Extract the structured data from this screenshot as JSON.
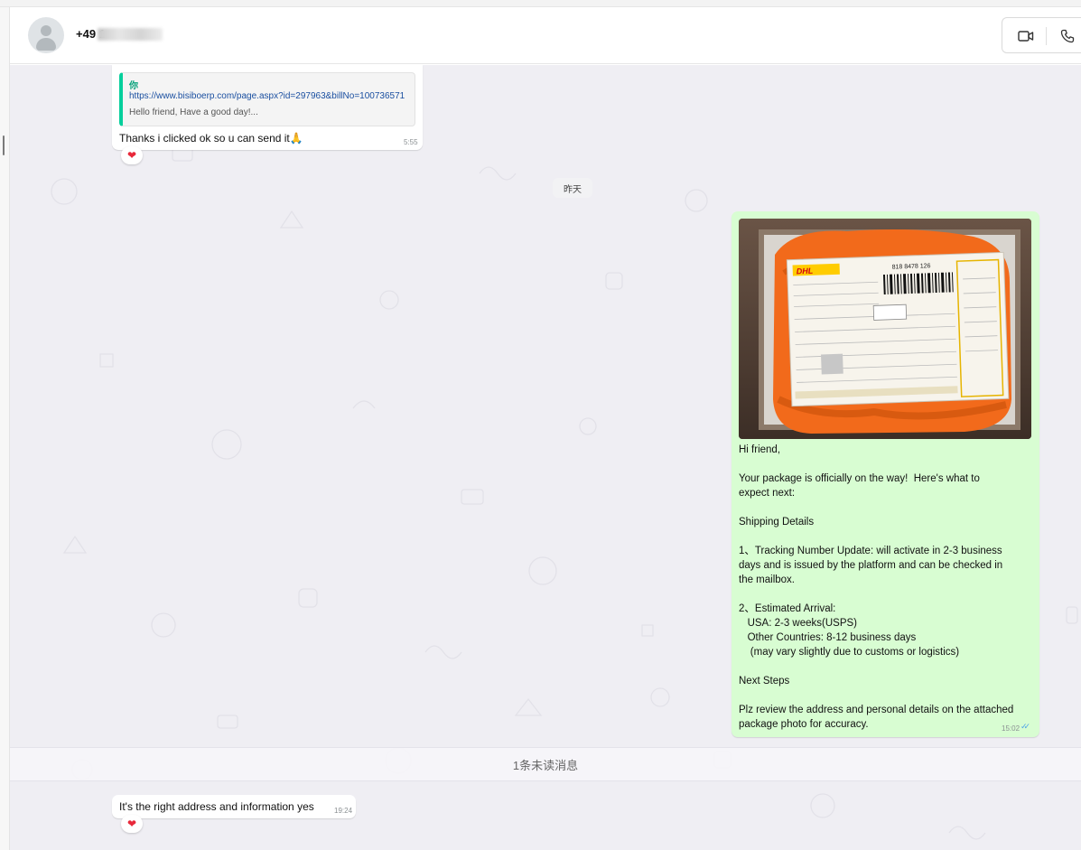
{
  "header": {
    "contact_name": "+49 1",
    "icons": {
      "video": "video-camera-icon",
      "phone": "phone-icon",
      "avatar": "default-avatar-icon"
    }
  },
  "chat": {
    "messages": [
      {
        "direction": "incoming",
        "quote": {
          "author": "你",
          "link": "https://www.bisiboerp.com/page.aspx?id=297963&billNo=100736571",
          "text": "Hello friend, Have a good day!..."
        },
        "text": "Thanks i clicked ok so u can send it🙏",
        "time": "5:55",
        "reaction": "❤"
      },
      {
        "direction": "outgoing",
        "has_image": true,
        "lines": [
          "Hi friend,",
          "",
          "Your package is officially on the way!  Here's what to",
          "expect next:",
          "",
          "Shipping Details",
          "",
          "1、Tracking Number Update: will activate in 2-3 business",
          "days and is issued by the platform and can be checked in",
          "the mailbox.",
          "",
          "2、Estimated Arrival:",
          "   USA: 2-3 weeks(USPS)",
          "   Other Countries: 8-12 business days",
          "    (may vary slightly due to customs or logistics)",
          "",
          "Next Steps",
          "",
          "Plz review the address and personal details on the attached",
          "package photo for accuracy."
        ],
        "time": "15:02",
        "status": "read"
      },
      {
        "direction": "incoming",
        "text": "It's the right address and information yes",
        "time": "19:24",
        "reaction": "❤"
      }
    ],
    "date_separator": "昨天",
    "unread_banner": "1条未读消息"
  },
  "photo": {
    "tracking_number": "818 8478 126",
    "carrier": "DHL"
  },
  "colors": {
    "chat_bg": "#efeef3",
    "outgoing_bubble": "#d8fdd2",
    "quote_accent": "#06cf9c",
    "read_ticks": "#4fa3e8"
  }
}
